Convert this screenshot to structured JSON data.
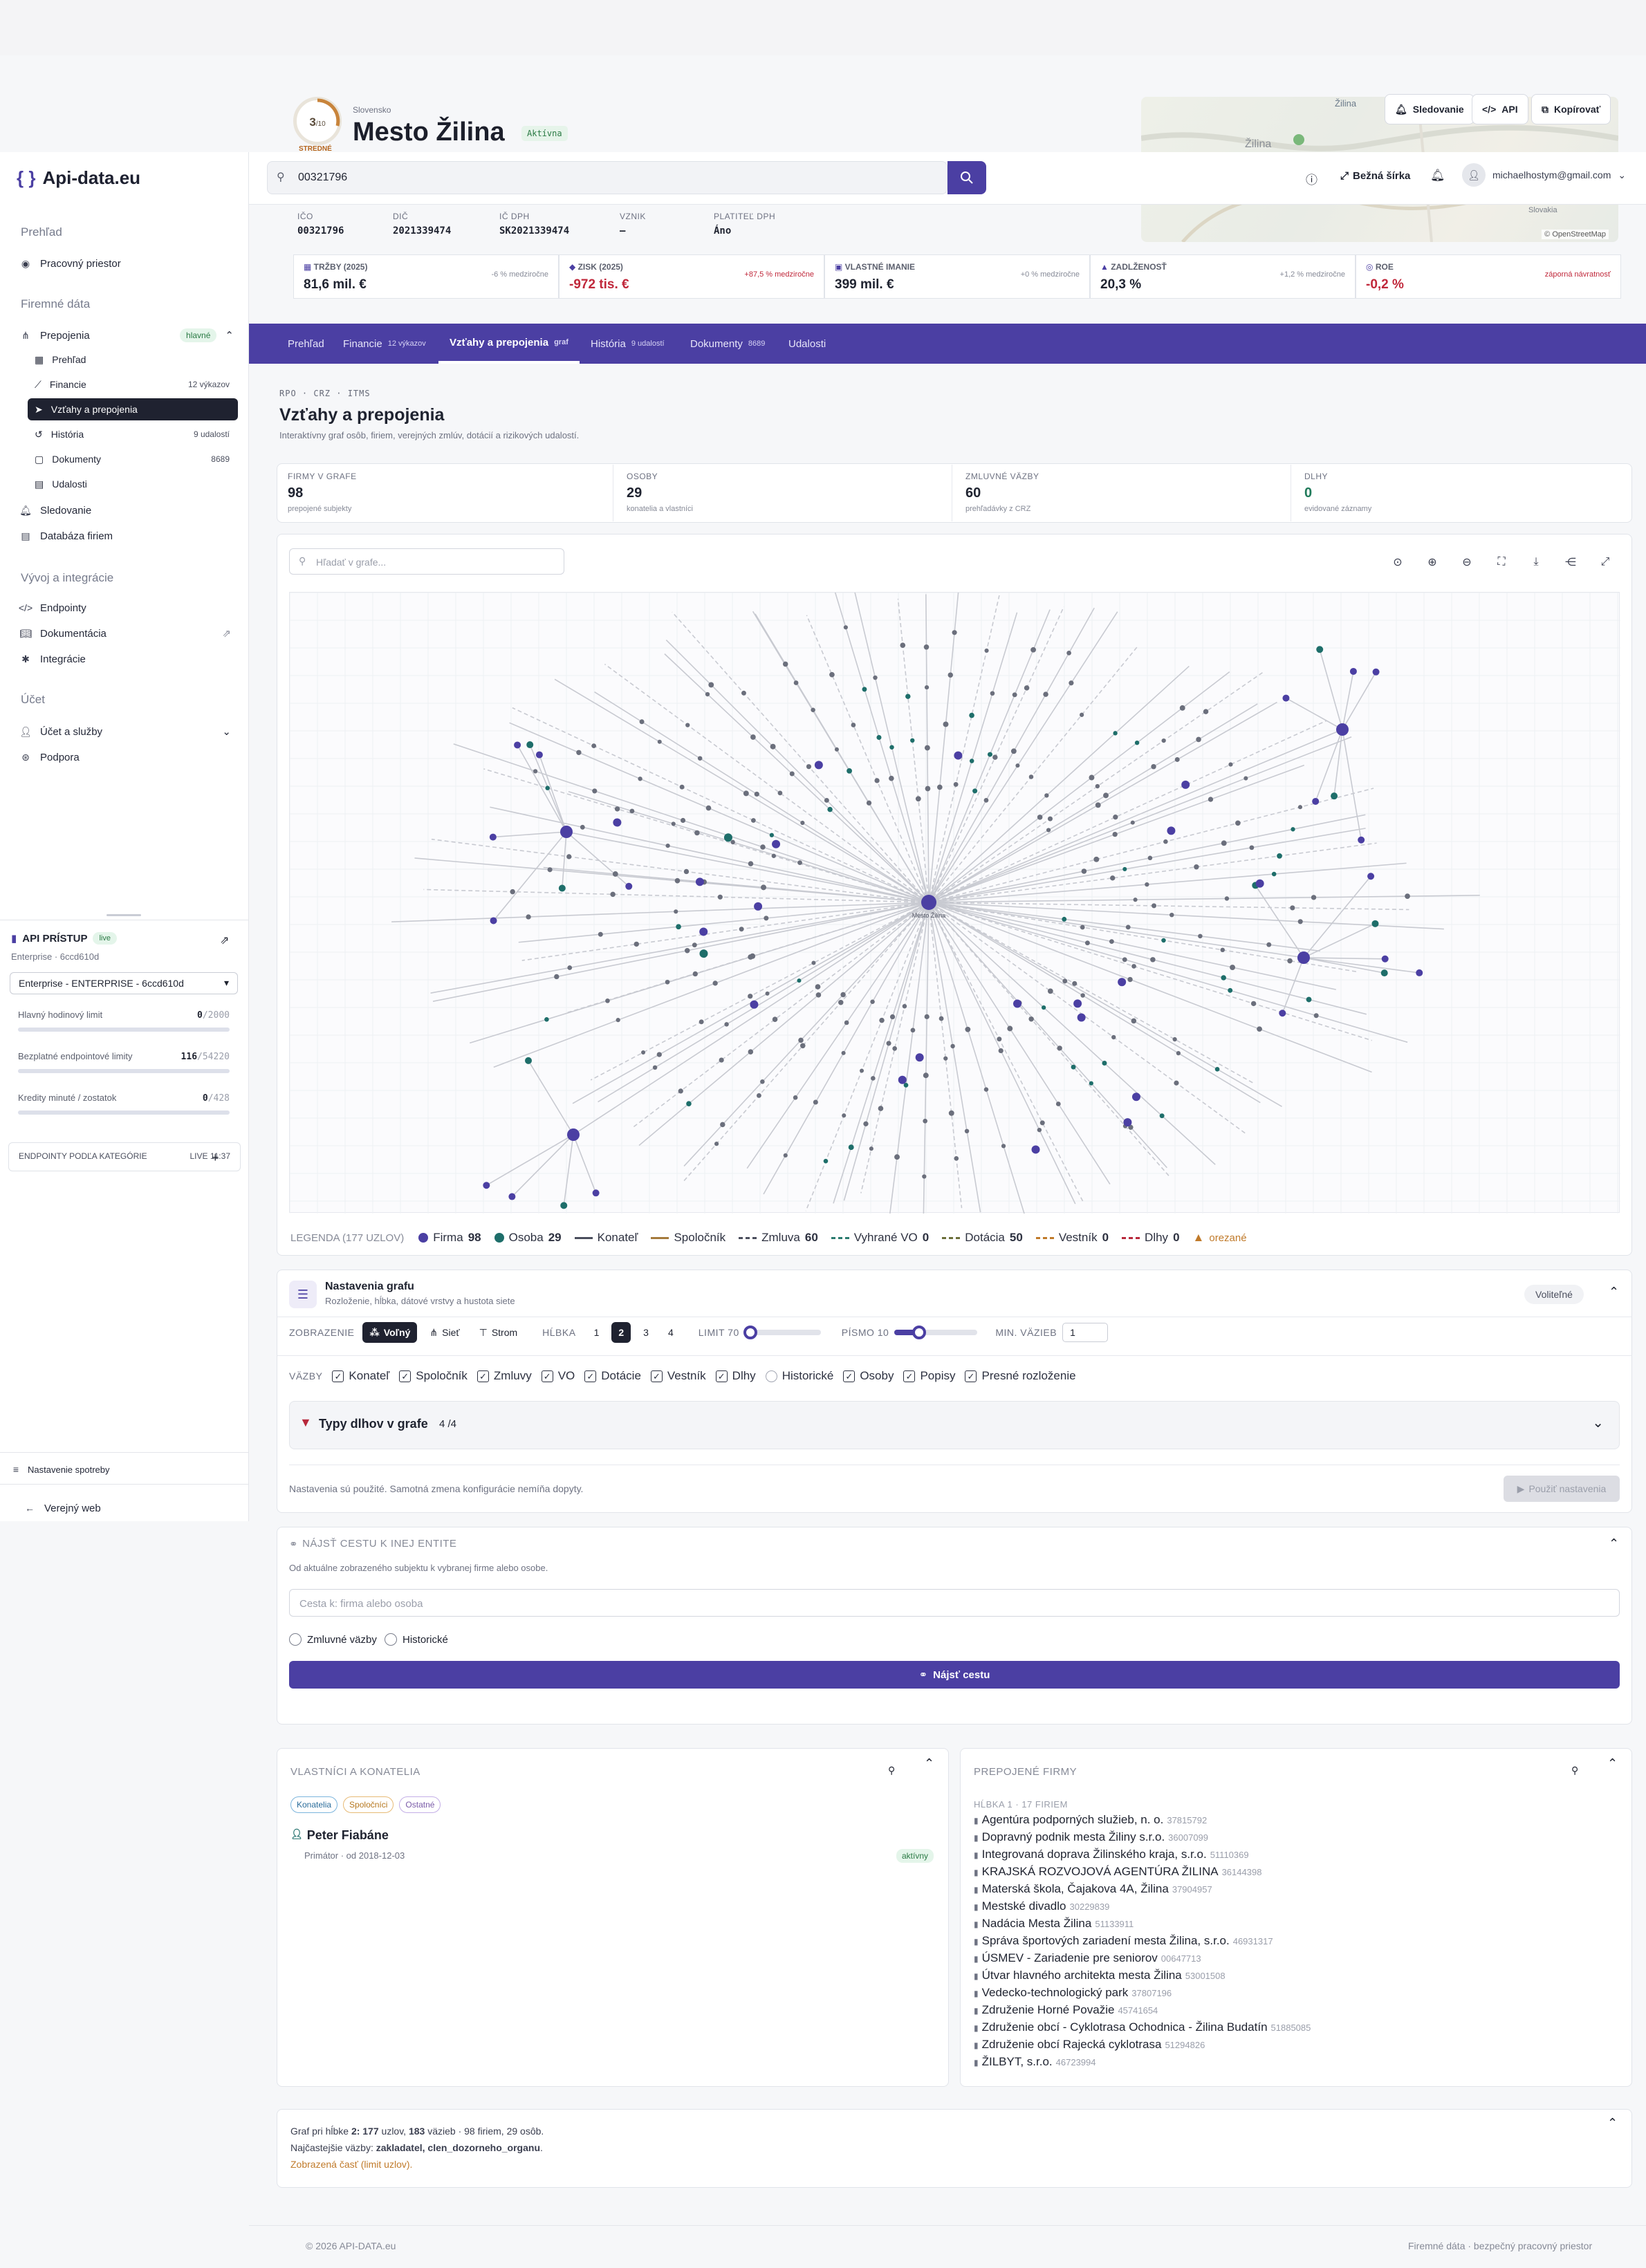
{
  "brand": "Api-data.eu",
  "search": {
    "value": "00321796"
  },
  "header": {
    "country": "Slovensko",
    "company_name": "Mesto Žilina",
    "status": "Aktívna",
    "score": "3",
    "score_max": "/10",
    "score_label": "STREDNÉ",
    "buttons": {
      "follow": "Sledovanie",
      "api": "API",
      "copy": "Kopírovať"
    },
    "width_toggle": "Bežná šírka",
    "user_email": "michaelhostym@gmail.com",
    "map_labels": [
      "Žilina",
      "Žilina",
      "Slovakia"
    ],
    "map_attribution": "© OpenStreetMap"
  },
  "ids": [
    {
      "label": "IČO",
      "value": "00321796"
    },
    {
      "label": "DIČ",
      "value": "2021339474"
    },
    {
      "label": "IČ DPH",
      "value": "SK2021339474"
    },
    {
      "label": "VZNIK",
      "value": "–"
    },
    {
      "label": "PLATITEĽ DPH",
      "value": "Áno"
    }
  ],
  "kpis": [
    {
      "label": "TRŽBY (2025)",
      "value": "81,6 mil. €",
      "change": "-6 % medziročne",
      "value_color": "#1f2330",
      "change_color": "#868a97"
    },
    {
      "label": "ZISK (2025)",
      "value": "-972 tis. €",
      "change": "+87,5 % medziročne",
      "value_color": "#c0283b",
      "change_color": "#c0283b"
    },
    {
      "label": "VLASTNÉ IMANIE",
      "value": "399 mil. €",
      "change": "+0 % medziročne",
      "value_color": "#1f2330",
      "change_color": "#868a97"
    },
    {
      "label": "ZADLŽENOSŤ",
      "value": "20,3 %",
      "change": "+1,2 % medziročne",
      "value_color": "#1f2330",
      "change_color": "#868a97"
    },
    {
      "label": "ROE",
      "value": "-0,2 %",
      "change": "záporná návratnosť",
      "value_color": "#c0283b",
      "change_color": "#c0283b"
    }
  ],
  "tabs": [
    {
      "label": "Prehľad",
      "badge": ""
    },
    {
      "label": "Financie",
      "badge": "12 výkazov"
    },
    {
      "label": "Vzťahy a prepojenia",
      "badge": "graf"
    },
    {
      "label": "História",
      "badge": "9 udalostí"
    },
    {
      "label": "Dokumenty",
      "badge": "8689"
    },
    {
      "label": "Udalosti",
      "badge": ""
    }
  ],
  "sidebar": {
    "overview": "Prehľad",
    "workspace": "Pracovný priestor",
    "company_data": "Firemné dáta",
    "connections": "Prepojenia",
    "connections_badge": "hlavné",
    "sub": [
      {
        "label": "Prehľad",
        "count": ""
      },
      {
        "label": "Financie",
        "count": "12 výkazov"
      },
      {
        "label": "Vzťahy a prepojenia",
        "count": ""
      },
      {
        "label": "História",
        "count": "9 udalostí"
      },
      {
        "label": "Dokumenty",
        "count": "8689"
      },
      {
        "label": "Udalosti",
        "count": ""
      }
    ],
    "following": "Sledovanie",
    "company_db": "Databáza firiem",
    "dev": "Vývoj a integrácie",
    "endpoints": "Endpointy",
    "docs": "Dokumentácia",
    "integrations": "Integrácie",
    "account": "Účet",
    "account_services": "Účet a služby",
    "support": "Podpora",
    "api_access": "API PRÍSTUP",
    "live": "live",
    "plan": "Enterprise · 6ccd610d",
    "plan_select": "Enterprise - ENTERPRISE - 6ccd610d",
    "limits": [
      {
        "label": "Hlavný hodinový limit",
        "used": "0",
        "total": "/2000"
      },
      {
        "label": "Bezplatné endpointové limity",
        "used": "116",
        "total": "/54220"
      },
      {
        "label": "Kredity minuté / zostatok",
        "used": "0",
        "total": "/428"
      }
    ],
    "endpoints_by_cat": "ENDPOINTY PODĽA KATEGÓRIE",
    "live_time": "LIVE 11:37",
    "usage_settings": "Nastavenie spotreby",
    "public_web": "Verejný web"
  },
  "section": {
    "crumbs": "RPO · CRZ · ITMS",
    "title": "Vzťahy a prepojenia",
    "subtitle": "Interaktívny graf osôb, firiem, verejných zmlúv, dotácií a rizikových udalostí."
  },
  "stats": [
    {
      "label": "FIRMY V GRAFE",
      "value": "98",
      "sub": "prepojené subjekty",
      "color": "#1f2330"
    },
    {
      "label": "OSOBY",
      "value": "29",
      "sub": "konatelia a vlastníci",
      "color": "#1f2330"
    },
    {
      "label": "ZMLUVNÉ VÄZBY",
      "value": "60",
      "sub": "prehľadávky z CRZ",
      "color": "#1f2330"
    },
    {
      "label": "DLHY",
      "value": "0",
      "sub": "evidované záznamy",
      "color": "#1f7a5a"
    }
  ],
  "graph": {
    "search_placeholder": "Hľadať v grafe...",
    "center_label": "Mesto Žilina",
    "colors": {
      "firma": "#4b3fa3",
      "osoba": "#1e6e6a",
      "small": "#6b6f7c"
    }
  },
  "legend": {
    "title": "LEGENDA (177 UZLOV)",
    "items": [
      {
        "label": "Firma",
        "count": "98"
      },
      {
        "label": "Osoba",
        "count": "29"
      },
      {
        "label": "Konateľ",
        "count": ""
      },
      {
        "label": "Spoločník",
        "count": ""
      },
      {
        "label": "Zmluva",
        "count": "60"
      },
      {
        "label": "Vyhrané VO",
        "count": "0"
      },
      {
        "label": "Dotácia",
        "count": "50"
      },
      {
        "label": "Vestník",
        "count": "0"
      },
      {
        "label": "Dlhy",
        "count": "0"
      }
    ],
    "trimmed": "orezané"
  },
  "settings": {
    "title": "Nastavenia grafu",
    "subtitle": "Rozloženie, hĺbka, dátové vrstvy a hustota siete",
    "optional": "Voliteľné",
    "view_label": "ZOBRAZENIE",
    "views": [
      "Voľný",
      "Sieť",
      "Strom"
    ],
    "depth_label": "HĹBKA",
    "depths": [
      "1",
      "2",
      "3",
      "4"
    ],
    "limit_label": "LIMIT 70",
    "font_label": "PÍSMO 10",
    "min_label": "MIN. VÄZIEB",
    "min_value": "1",
    "links_label": "VÄZBY",
    "checks": [
      {
        "label": "Konateľ",
        "on": true
      },
      {
        "label": "Spoločník",
        "on": true
      },
      {
        "label": "Zmluvy",
        "on": true
      },
      {
        "label": "VO",
        "on": true
      },
      {
        "label": "Dotácie",
        "on": true
      },
      {
        "label": "Vestník",
        "on": true
      },
      {
        "label": "Dlhy",
        "on": true
      },
      {
        "label": "Historické",
        "on": false
      },
      {
        "label": "Osoby",
        "on": true
      },
      {
        "label": "Popisy",
        "on": true
      },
      {
        "label": "Presné rozloženie",
        "on": true
      }
    ],
    "debts_title": "Typy dlhov v grafe",
    "debts_count": "4 /4",
    "applied_note": "Nastavenia sú použité. Samotná zmena konfigurácie nemíňa dopyty.",
    "apply_btn": "Použiť nastavenia"
  },
  "path": {
    "title": "NÁJSŤ CESTU K INEJ ENTITE",
    "subtitle": "Od aktuálne zobrazeného subjektu k vybranej firme alebo osobe.",
    "placeholder": "Cesta k: firma alebo osoba",
    "opt1": "Zmluvné väzby",
    "opt2": "Historické",
    "button": "Nájsť cestu"
  },
  "owners": {
    "title": "VLASTNÍCI A KONATELIA",
    "chips": [
      "Konatelia",
      "Spoločníci",
      "Ostatné"
    ],
    "person": "Peter Fiabáne",
    "role": "Primátor · od 2018-12-03",
    "status": "aktívny"
  },
  "companies": {
    "title": "PREPOJENÉ FIRMY",
    "level": "HĹBKA 1 · 17 FIRIEM",
    "list": [
      {
        "name": "Agentúra podporných služieb, n. o.",
        "ico": "37815792"
      },
      {
        "name": "Dopravný podnik mesta Žiliny s.r.o.",
        "ico": "36007099"
      },
      {
        "name": "Integrovaná doprava Žilinského kraja, s.r.o.",
        "ico": "51110369"
      },
      {
        "name": "KRAJSKÁ ROZVOJOVÁ AGENTÚRA ŽILINA",
        "ico": "36144398"
      },
      {
        "name": "Materská škola, Čajakova 4A, Žilina",
        "ico": "37904957"
      },
      {
        "name": "Mestské divadlo",
        "ico": "30229839"
      },
      {
        "name": "Nadácia Mesta Žilina",
        "ico": "51133911"
      },
      {
        "name": "Správa športových zariadení mesta Žilina, s.r.o.",
        "ico": "46931317"
      },
      {
        "name": "ÚSMEV - Zariadenie pre seniorov",
        "ico": "00647713"
      },
      {
        "name": "Útvar hlavného architekta mesta Žilina",
        "ico": "53001508"
      },
      {
        "name": "Vedecko-technologický park",
        "ico": "37807196"
      },
      {
        "name": "Združenie Horné Považie",
        "ico": "45741654"
      },
      {
        "name": "Združenie obcí - Cyklotrasa Ochodnica - Žilina Budatín",
        "ico": "51885085"
      },
      {
        "name": "Združenie obcí Rajecká cyklotrasa",
        "ico": "51294826"
      },
      {
        "name": "ŽILBYT, s.r.o.",
        "ico": "46723994"
      }
    ]
  },
  "summary": {
    "line1_a": "Graf pri hĺbke",
    "line1_b": "2: 177",
    "line1_c": "uzlov,",
    "line1_d": "183",
    "line1_e": "väzieb · 98 firiem, 29 osôb.",
    "line2_a": "Najčastejšie väzby:",
    "line2_b": "zakladatel, clen_dozorneho_organu",
    "line3": "Zobrazená časť (limit uzlov)."
  },
  "footer": {
    "left": "© 2026 API-DATA.eu",
    "right": "Firemné dáta · bezpečný pracovný priestor"
  }
}
